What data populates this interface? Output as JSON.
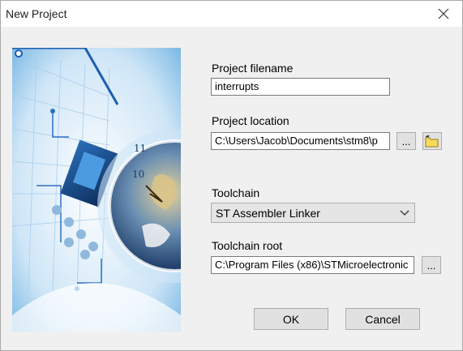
{
  "window": {
    "title": "New Project"
  },
  "fields": {
    "filename_label": "Project filename",
    "filename_value": "interrupts",
    "location_label": "Project location",
    "location_value": "C:\\Users\\Jacob\\Documents\\stm8\\p",
    "browse_label": "...",
    "toolchain_label": "Toolchain",
    "toolchain_value": "ST Assembler Linker",
    "root_label": "Toolchain root",
    "root_value": "C:\\Program Files (x86)\\STMicroelectronic",
    "root_browse_label": "..."
  },
  "buttons": {
    "ok": "OK",
    "cancel": "Cancel"
  },
  "icons": {
    "close": "close-icon",
    "new_folder": "new-folder-icon",
    "dropdown": "chevron-down-icon"
  }
}
